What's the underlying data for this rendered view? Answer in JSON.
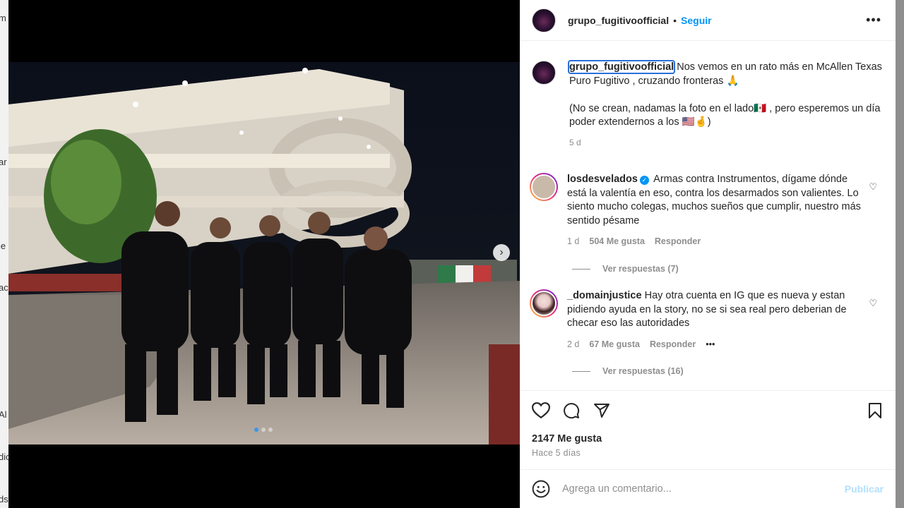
{
  "background": {
    "fragments": [
      "m",
      "ar",
      "je",
      "ac",
      "Al",
      "dic",
      "ds"
    ]
  },
  "post": {
    "username": "grupo_fugitivoofficial",
    "separator": "•",
    "follow_label": "Seguir",
    "more_icon": "more-horizontal-icon",
    "caption_lines": [
      "Nos vemos en un rato más en McAllen Texas",
      "Puro Fugitivo , cruzando fronteras 🙏",
      "",
      "(No se crean, nadamas la foto en el lado🇲🇽 , pero esperemos un día poder extendernos a los 🇺🇸🤞)"
    ],
    "caption_age": "5 d",
    "next_icon": "›",
    "carousel_active_index": 0,
    "carousel_count": 3
  },
  "comments": [
    {
      "username": "losdesvelados",
      "verified": true,
      "text": "Armas contra Instrumentos, dígame dónde está la valentía en eso, contra los desarmados son valientes. Lo siento mucho colegas, muchos sueños que cumplir, nuestro más sentido pésame",
      "age": "1 d",
      "likes": "504 Me gusta",
      "reply": "Responder",
      "view_replies": "Ver respuestas (7)"
    },
    {
      "username": "_domainjustice",
      "verified": false,
      "text": "Hay otra cuenta en IG que es nueva y estan pidiendo ayuda en la story, no se si sea real pero deberian de checar eso las autoridades",
      "age": "2 d",
      "likes": "67 Me gusta",
      "reply": "Responder",
      "more": "•••",
      "view_replies": "Ver respuestas (16)"
    }
  ],
  "actions": {
    "likes": "2147 Me gusta",
    "posted": "Hace 5 días"
  },
  "composer": {
    "placeholder": "Agrega un comentario...",
    "publish_label": "Publicar"
  },
  "colors": {
    "accent": "#0095f6",
    "publish_disabled": "#b2dffc",
    "muted": "#8e8e8e",
    "text": "#262626"
  }
}
